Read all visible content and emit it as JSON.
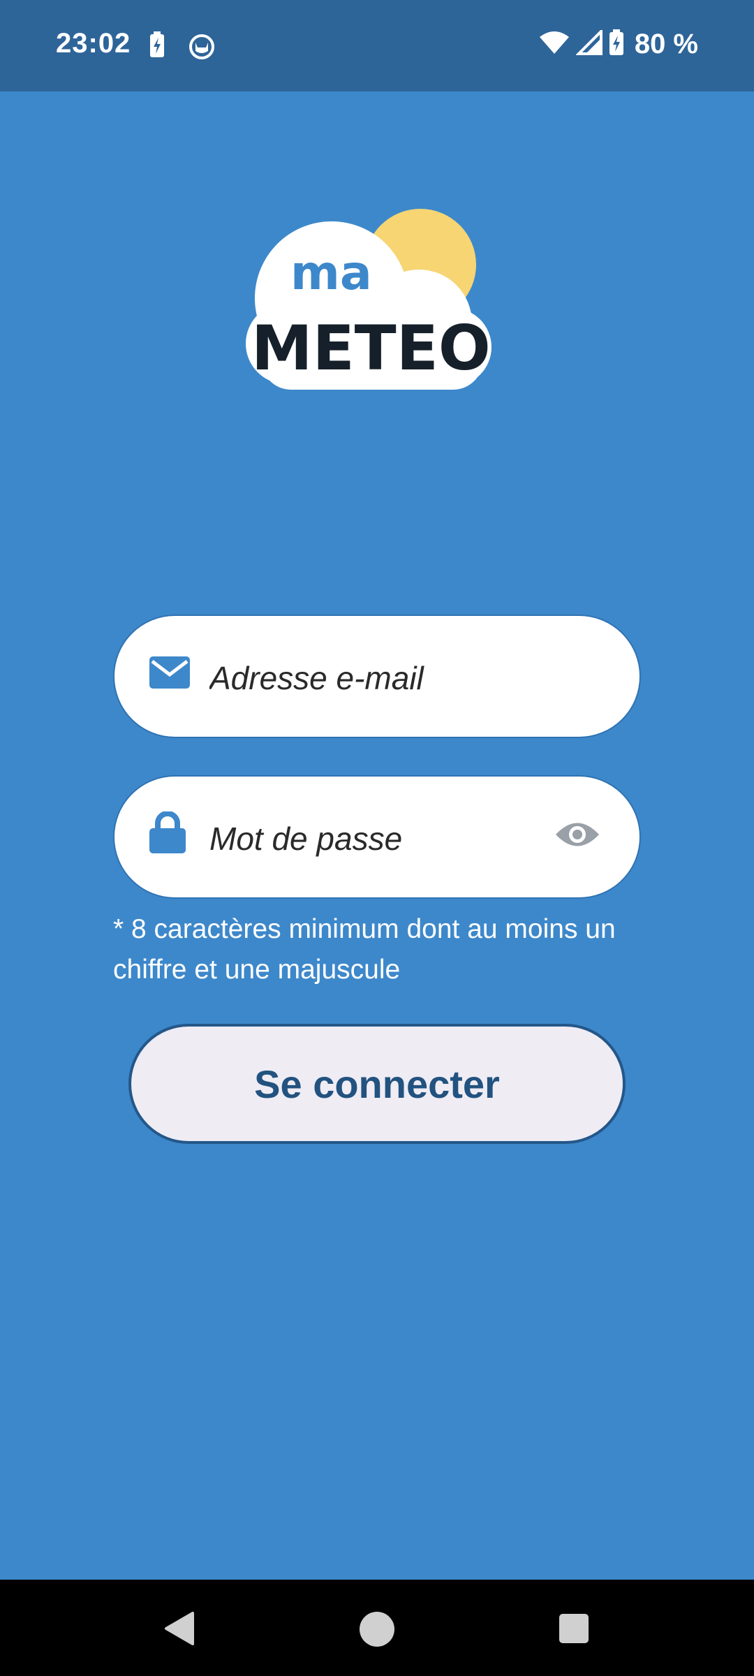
{
  "status_bar": {
    "time": "23:02",
    "battery_percent": "80 %",
    "icons": [
      "battery-saver-icon",
      "cat-face-icon",
      "wifi-icon",
      "cell-signal-icon",
      "battery-charging-icon"
    ]
  },
  "logo": {
    "top_text": "ma",
    "main_text": "METEO",
    "colors": {
      "sun": "#f6d572",
      "cloud": "#ffffff",
      "ma": "#3d88cb",
      "meteo": "#16202a"
    }
  },
  "form": {
    "email_placeholder": "Adresse e-mail",
    "email_value": "",
    "password_placeholder": "Mot de passe",
    "password_value": "",
    "password_hint": "* 8 caractères minimum dont au moins un chiffre et une majuscule",
    "submit_label": "Se connecter"
  },
  "nav_bar": {
    "icons": [
      "back-icon",
      "home-icon",
      "recents-icon"
    ]
  },
  "colors": {
    "background": "#3d88cb",
    "status_bar": "#2e6599",
    "button_bg": "#efecf4",
    "button_text": "#22527f",
    "accent": "#3d88cb"
  }
}
